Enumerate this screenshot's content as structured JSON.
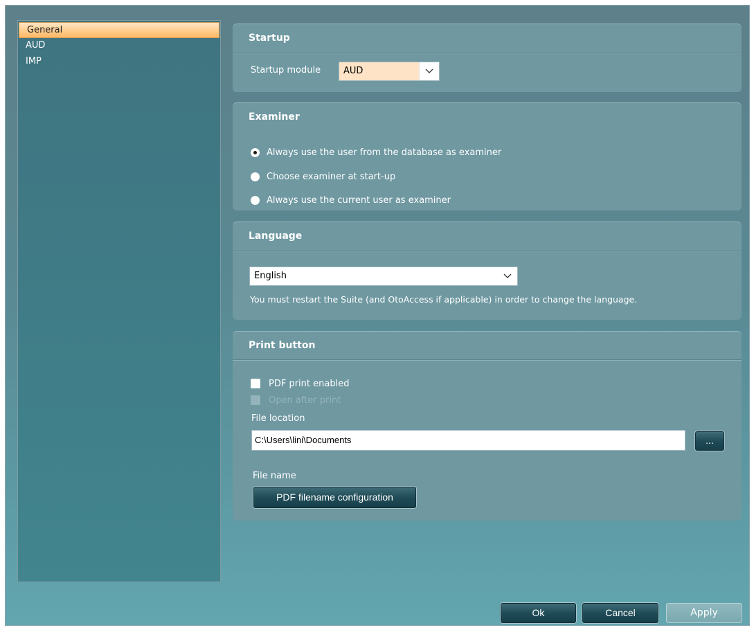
{
  "sidebar": {
    "items": [
      {
        "label": "General",
        "selected": true
      },
      {
        "label": "AUD",
        "selected": false
      },
      {
        "label": "IMP",
        "selected": false
      }
    ]
  },
  "startup": {
    "title": "Startup",
    "module_label": "Startup module",
    "module_value": "AUD"
  },
  "examiner": {
    "title": "Examiner",
    "options": [
      {
        "label": "Always use the user from the database as examiner",
        "checked": true
      },
      {
        "label": "Choose examiner at start-up",
        "checked": false
      },
      {
        "label": "Always use the current user as examiner",
        "checked": false
      }
    ]
  },
  "language": {
    "title": "Language",
    "value": "English",
    "note": "You must restart the Suite (and OtoAccess if applicable) in order to change the language."
  },
  "print": {
    "title": "Print button",
    "pdf_enabled_label": "PDF print enabled",
    "open_after_label": "Open after print",
    "file_location_label": "File location",
    "file_location_value": "C:\\Users\\lini\\Documents",
    "browse_label": "...",
    "file_name_label": "File name",
    "filename_config_label": "PDF filename configuration"
  },
  "footer": {
    "ok": "Ok",
    "cancel": "Cancel",
    "apply": "Apply"
  },
  "colors": {
    "selected_item": "#ffc27a",
    "startup_combo": "#ffe3c6",
    "panel": "#6f98a1"
  }
}
